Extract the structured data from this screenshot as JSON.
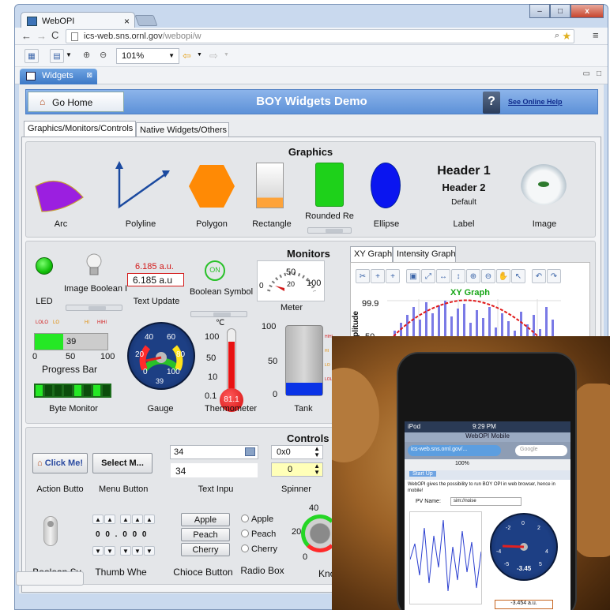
{
  "browser": {
    "tab_title": "WebOPI",
    "url_host": "ics-web.sns.ornl.gov",
    "url_path": "/webopi/w",
    "zoom": "101%",
    "view_tab": "Widgets",
    "window_close": "x",
    "window_min": "–",
    "window_max": "□"
  },
  "header": {
    "go_home": "Go Home",
    "title": "BOY Widgets Demo",
    "help_link": "See Online Help",
    "help_icon_text": "?"
  },
  "tabs": [
    "Graphics/Monitors/Controls",
    "Native Widgets/Others"
  ],
  "graphics": {
    "title": "Graphics",
    "labels": [
      "Arc",
      "Polyline",
      "Polygon",
      "Rectangle",
      "Rounded Re",
      "Ellipse",
      "Label",
      "Image"
    ],
    "header1": "Header 1",
    "header2": "Header 2",
    "default": "Default"
  },
  "monitors": {
    "title": "Monitors",
    "led": "LED",
    "image_boolean": "Image Boolean I",
    "text_update_top": "6.185 a.u.",
    "text_update_box": "6.185 a.u",
    "text_update": "Text Update",
    "bool_symbol_on": "ON",
    "boolean_symbol": "Boolean Symbol",
    "meter": "Meter",
    "meter_ticks": [
      "0",
      "50",
      "100"
    ],
    "meter_value": "20",
    "progress_bar": "Progress Bar",
    "progress_marks": [
      "LOLO",
      "LO",
      "HI",
      "HIHI"
    ],
    "progress_value": "39",
    "progress_fraction": 0.39,
    "progress_ticks": [
      "0",
      "50",
      "100"
    ],
    "gauge": "Gauge",
    "gauge_ticks": [
      "0",
      "20",
      "40",
      "60",
      "80",
      "100"
    ],
    "gauge_value": "39",
    "thermometer": "Thermometer",
    "thermo_unit": "℃",
    "thermo_ticks": [
      "100",
      "50",
      "10",
      "0.1"
    ],
    "thermo_value": "81.1",
    "tank": "Tank",
    "tank_ticks": [
      "100",
      "50",
      "0"
    ],
    "tank_marks": [
      "HIHI",
      "HI",
      "LO",
      "LOLO"
    ],
    "byte_monitor": "Byte Monitor"
  },
  "xy": {
    "tabs": [
      "XY Graph",
      "Intensity Graph"
    ],
    "graph_title": "XY Graph",
    "y_ticks": [
      "99.9",
      "50"
    ],
    "ylabel": "plitude"
  },
  "controls": {
    "title": "Controls",
    "click_me": "Click Me!",
    "select_menu": "Select M...",
    "action_button": "Action Butto",
    "menu_button": "Menu Button",
    "text_input_1": "34",
    "text_input_2": "34",
    "text_input": "Text Inpu",
    "spinner_1": "0x0",
    "spinner_2": "0",
    "spinner": "Spinner",
    "boolean_switch": "Boolean Sv",
    "thumb_wheel": "Thumb Whe",
    "thumb_digits": "0 0 . 0 0 0",
    "choice_items": [
      "Apple",
      "Peach",
      "Cherry"
    ],
    "choice_button": "Chioce Button",
    "radio_items": [
      "Apple",
      "Peach",
      "Cherry"
    ],
    "radio_box": "Radio Box",
    "knob": "Kno",
    "knob_ticks": [
      "40",
      "20",
      "0"
    ]
  },
  "phone": {
    "carrier": "iPod",
    "time": "9:29 PM",
    "app_title": "WebOPI Mobile",
    "url": "ics-web.sns.ornl.gov/...",
    "search": "Google",
    "zoom": "100%",
    "tab": "Start Up",
    "intro": "WebOPI gives the possibility to run BOY OPI in web browser, hence in mobile!",
    "pv_label": "PV Name:",
    "pv_value": "sim://noise",
    "gauge_value": "-3.45",
    "readout": "-3.454 a.u.",
    "gauge_ticks": [
      "-2",
      "0",
      "2",
      "-4",
      "4",
      "-5",
      "5"
    ]
  }
}
